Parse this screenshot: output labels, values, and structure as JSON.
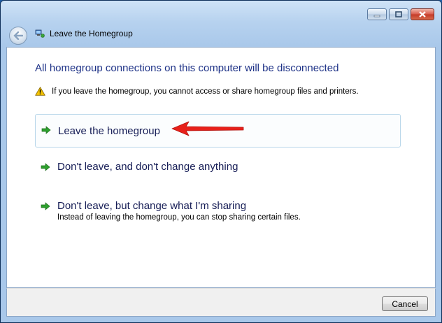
{
  "window": {
    "title": "Leave the Homegroup",
    "controls": {
      "minimize": "minimize",
      "maximize": "maximize",
      "close": "close"
    }
  },
  "content": {
    "heading": "All homegroup connections on this computer will be disconnected",
    "warning": "If you leave the homegroup, you cannot access or share homegroup files and printers.",
    "options": [
      {
        "label": "Leave the homegroup",
        "sub": ""
      },
      {
        "label": "Don't leave, and don't change anything",
        "sub": ""
      },
      {
        "label": "Don't leave, but change what I'm sharing",
        "sub": "Instead of leaving the homegroup, you can stop sharing certain files."
      }
    ]
  },
  "footer": {
    "cancel_label": "Cancel"
  },
  "colors": {
    "heading": "#1e3287",
    "option_text": "#151c55",
    "green_arrow": "#2ea12e",
    "annotation_arrow": "#e8201a",
    "warning_yellow": "#f5c400"
  }
}
